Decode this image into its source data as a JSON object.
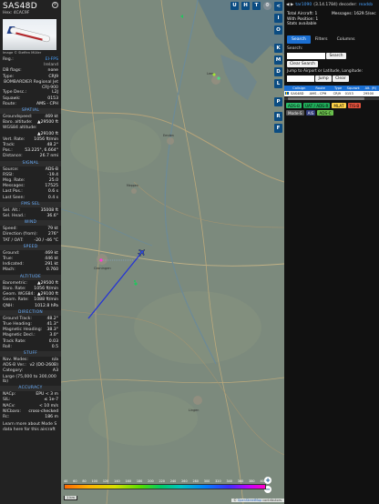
{
  "detail": {
    "callsign": "SAS48D",
    "hex_label": "Hex:",
    "hex": "4CAC9F",
    "photo_credit": "Image © Steffen Müller",
    "reg_label": "Reg.:",
    "reg": "EI-FPS",
    "country": "Ireland",
    "db_flags_label": "DB flags:",
    "db_flags": "none",
    "type_label": "Type:",
    "type": "CRJ9",
    "type_desc": "BOMBARDIER Regional Jet CRJ-900",
    "type_desc_label": "Type Desc.:",
    "type_desc_code": "L2J",
    "squawk_label": "Squawk:",
    "squawk": "0153",
    "route_label": "Route:",
    "route": "AMS - CPH",
    "sections": {
      "spatial": "SPATIAL",
      "signal": "SIGNAL",
      "fms": "FMS SEL",
      "wind": "WIND",
      "speed": "SPEED",
      "altitude": "ALTITUDE",
      "direction": "DIRECTION",
      "stuff": "STUFF",
      "accuracy": "ACCURACY"
    },
    "spatial": [
      {
        "k": "Groundspeed:",
        "v": "469 kt"
      },
      {
        "k": "Baro. altitude:",
        "v": "▲29500 ft"
      },
      {
        "k": "WGS84 altitude:",
        "v": ""
      },
      {
        "k": "",
        "v": "▲29100 ft"
      },
      {
        "k": "Vert. Rate:",
        "v": "1056 ft/min"
      },
      {
        "k": "Track:",
        "v": "48.2°"
      },
      {
        "k": "Pos.:",
        "v": "53.225°, 6.664°"
      },
      {
        "k": "Distance:",
        "v": "26.7 nmi"
      }
    ],
    "signal": [
      {
        "k": "Source:",
        "v": "ADS-B"
      },
      {
        "k": "RSSI:",
        "v": "-19.4"
      },
      {
        "k": "Msg. Rate:",
        "v": "25.0"
      },
      {
        "k": "Messages:",
        "v": "17525"
      },
      {
        "k": "Last Pos.:",
        "v": "0.6 s"
      },
      {
        "k": "Last Seen:",
        "v": "0.4 s"
      }
    ],
    "fms": [
      {
        "k": "Sel. Alt.:",
        "v": "35008 ft"
      },
      {
        "k": "Sel. Head.:",
        "v": "36.6°"
      }
    ],
    "wind": [
      {
        "k": "Speed:",
        "v": "79 kt"
      },
      {
        "k": "Direction (from):",
        "v": "276°"
      },
      {
        "k": "TAT / OAT:",
        "v": "-20 / -46 °C"
      }
    ],
    "speed": [
      {
        "k": "Ground:",
        "v": "469 kt"
      },
      {
        "k": "True:",
        "v": "446 kt"
      },
      {
        "k": "Indicated:",
        "v": "291 kt"
      },
      {
        "k": "Mach:",
        "v": "0.760"
      }
    ],
    "altitude": [
      {
        "k": "Barometric:",
        "v": "▲29500 ft"
      },
      {
        "k": "Baro. Rate:",
        "v": "1056 ft/min"
      },
      {
        "k": "Geom. WGS84:",
        "v": "▲29100 ft"
      },
      {
        "k": "Geom. Rate:",
        "v": "1088 ft/min"
      },
      {
        "k": "QNH:",
        "v": "1012.8 hPa"
      }
    ],
    "direction": [
      {
        "k": "Ground Track:",
        "v": "48.2°"
      },
      {
        "k": "True Heading:",
        "v": "41.3°"
      },
      {
        "k": "Magnetic Heading:",
        "v": "38.3°"
      },
      {
        "k": "Magnetic Decl.:",
        "v": "3.0°"
      },
      {
        "k": "Track Rate:",
        "v": "0.03"
      },
      {
        "k": "Roll:",
        "v": "0.5"
      }
    ],
    "stuff": [
      {
        "k": "Nav. Modes:",
        "v": "n/a"
      },
      {
        "k": "ADS-B Ver.:",
        "v": "v2 (DO-260B)"
      },
      {
        "k": "Category:",
        "v": "A3"
      }
    ],
    "category_desc": "Large (75,000 to 300,000 lb)",
    "accuracy": [
      {
        "k": "NACp:",
        "v": "EPU < 3 m"
      },
      {
        "k": "SIL:",
        "v": "≤ 1e-7"
      },
      {
        "k": "NACv:",
        "v": "< 10 m/s"
      },
      {
        "k": "NICbaro:",
        "v": "cross-checked"
      },
      {
        "k": "Rc:",
        "v": "186 m"
      }
    ],
    "footer_text": "Learn more about Mode S data here for this aircraft"
  },
  "map": {
    "top_buttons": [
      "U",
      "H",
      "T"
    ],
    "side_buttons": [
      "<",
      "I",
      "O",
      "K",
      "M",
      "D",
      "L",
      "P",
      "R",
      "F"
    ],
    "zoom_in": "+",
    "zoom_out": "−",
    "alt_ticks": [
      "40",
      "60",
      "80",
      "100",
      "120",
      "140",
      "160",
      "180",
      "200",
      "220",
      "240",
      "260",
      "280",
      "300",
      "320",
      "340",
      "360",
      "380",
      "400"
    ],
    "scale": "1 km",
    "attrib_prefix": "©",
    "attrib_link": "OpenStreetMap",
    "attrib_suffix": "contributors.",
    "towns": [
      "Bremen",
      "Hamburg",
      "Groningen",
      "Oldenburg",
      "Emden",
      "Leer",
      "Meppen",
      "Lingen"
    ]
  },
  "right": {
    "nav_arrows": "◀ ▶",
    "version_link": "tar1090",
    "version_text": "(3.14.1784) decoder:",
    "decoder_link": "readsb",
    "stats": [
      {
        "k": "Total Aircraft: 1",
        "v": "Messages: 1629.5/sec"
      },
      {
        "k": "With Position: 1",
        "v": ""
      },
      {
        "k": "Stats available",
        "v": ""
      }
    ],
    "tabs": [
      "Search",
      "Filters",
      "Columns"
    ],
    "search_label": "Search:",
    "search_button": "Search",
    "clear_search_button": "Clear Search",
    "jump_label": "Jump to Airport or Latitude, Longitude:",
    "jump_button": "Jump",
    "clear_button": "Clear",
    "table_headers": [
      "",
      "Callsign",
      "Route",
      "Type",
      "Squawk",
      "Alt. (ft)"
    ],
    "table_rows": [
      {
        "callsign": "SAS48D",
        "route": "AMS - CPH",
        "type": "CRJ9",
        "squawk": "0153",
        "alt": "29500"
      }
    ],
    "badges": [
      {
        "label": "ADS-B",
        "cls": "adsb"
      },
      {
        "label": "UAT / ADS-R",
        "cls": "uat"
      },
      {
        "label": "MLAT",
        "cls": "mlat"
      },
      {
        "label": "TIS-B",
        "cls": "tisb"
      },
      {
        "label": "Mode-S",
        "cls": "modes"
      },
      {
        "label": "AIS",
        "cls": "ais"
      },
      {
        "label": "ADS-C",
        "cls": "adsc"
      }
    ]
  }
}
